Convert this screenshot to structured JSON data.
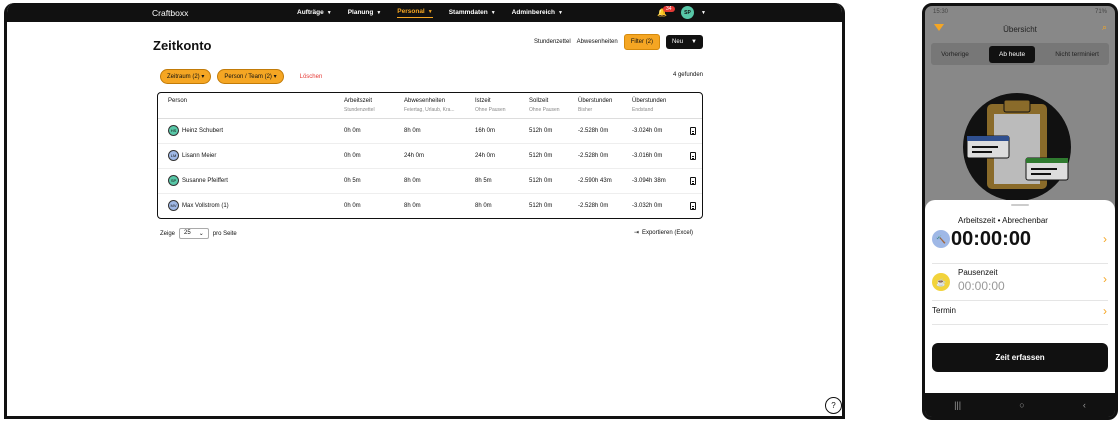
{
  "app": {
    "brand": "Craftboxx"
  },
  "nav": {
    "items": [
      {
        "label": "Aufträge"
      },
      {
        "label": "Planung"
      },
      {
        "label": "Personal"
      },
      {
        "label": "Stammdaten"
      },
      {
        "label": "Adminbereich"
      }
    ],
    "active": "Personal",
    "notifications_badge": "34",
    "user_initials": "SP"
  },
  "page": {
    "title": "Zeitkonto",
    "links": {
      "stundenzettel": "Stundenzettel",
      "abwesenheiten": "Abwesenheiten"
    },
    "filter_button": "Filter (2)",
    "new_button": "Neu",
    "chips": [
      "Zeitraum (2)",
      "Person / Team (2)"
    ],
    "clear_label": "Löschen",
    "found_label": "4 gefunden"
  },
  "table": {
    "columns": [
      {
        "label": "Person",
        "sub": ""
      },
      {
        "label": "Arbeitszeit",
        "sub": "Stundenzettel"
      },
      {
        "label": "Abwesenheiten",
        "sub": "Feiertag, Urlaub, Kra..."
      },
      {
        "label": "Istzeit",
        "sub": "Ohne Pausen"
      },
      {
        "label": "Sollzeit",
        "sub": "Ohne Pausen"
      },
      {
        "label": "Überstunden",
        "sub": "Bisher"
      },
      {
        "label": "Überstunden",
        "sub": "Endstand"
      }
    ],
    "rows": [
      {
        "initials": "HS",
        "name": "Heinz Schubert",
        "arbeitszeit": "0h 0m",
        "abwesenheiten": "8h 0m",
        "istzeit": "16h 0m",
        "sollzeit": "512h 0m",
        "ueber_bisher": "-2.528h 0m",
        "ueber_end": "-3.024h 0m",
        "color": "#58c7a7"
      },
      {
        "initials": "LM",
        "name": "Lisann Meier",
        "arbeitszeit": "0h 0m",
        "abwesenheiten": "24h 0m",
        "istzeit": "24h 0m",
        "sollzeit": "512h 0m",
        "ueber_bisher": "-2.528h 0m",
        "ueber_end": "-3.016h 0m",
        "color": "#9fb8e6"
      },
      {
        "initials": "SP",
        "name": "Susanne Pfeiffert",
        "arbeitszeit": "0h 5m",
        "abwesenheiten": "8h 0m",
        "istzeit": "8h 5m",
        "sollzeit": "512h 0m",
        "ueber_bisher": "-2.590h 43m",
        "ueber_end": "-3.094h 38m",
        "color": "#58c7a7"
      },
      {
        "initials": "MV",
        "name": "Max Vollstrom (1)",
        "arbeitszeit": "0h 0m",
        "abwesenheiten": "8h 0m",
        "istzeit": "8h 0m",
        "sollzeit": "512h 0m",
        "ueber_bisher": "-2.528h 0m",
        "ueber_end": "-3.032h 0m",
        "color": "#9fb8e6"
      }
    ]
  },
  "pager": {
    "prefix": "Zeige",
    "value": "25",
    "suffix": "pro Seite"
  },
  "export_label": "Exportieren (Excel)",
  "help_label": "?",
  "phone": {
    "time": "15:30",
    "status_right": "71%",
    "title": "Übersicht",
    "segments": [
      "Vorherige",
      "Ab heute",
      "Nicht terminiert"
    ],
    "active_segment": "Ab heute",
    "arbeitszeit_label": "Arbeitszeit • Abrechenbar",
    "arbeitszeit_value": "00:00:00",
    "pausen_label": "Pausenzeit",
    "pausen_value": "00:00:00",
    "termin_label": "Termin",
    "cta": "Zeit erfassen"
  },
  "colors": {
    "accent": "#f5a623",
    "dark": "#111111",
    "danger": "#e53935"
  }
}
